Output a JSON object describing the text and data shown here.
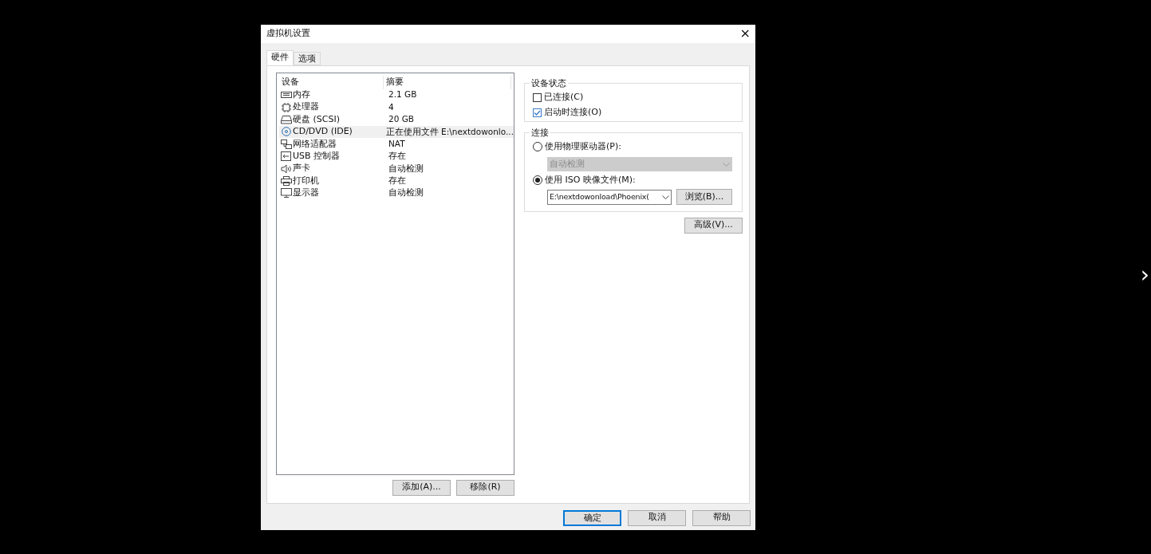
{
  "window": {
    "title": "虚拟机设置",
    "close": "×"
  },
  "tabs": [
    {
      "label": "硬件",
      "selected": true
    },
    {
      "label": "选项",
      "selected": false
    }
  ],
  "devices": {
    "columns": [
      "设备",
      "摘要"
    ],
    "rows": [
      {
        "kind": "memory",
        "name": "内存",
        "summary": "2.1 GB",
        "selected": false
      },
      {
        "kind": "cpu",
        "name": "处理器",
        "summary": "4",
        "selected": false
      },
      {
        "kind": "disk",
        "name": "硬盘 (SCSI)",
        "summary": "20 GB",
        "selected": false
      },
      {
        "kind": "cdrom",
        "name": "CD/DVD (IDE)",
        "summary": "正在使用文件 E:\\nextdowonlo...",
        "selected": true
      },
      {
        "kind": "network",
        "name": "网络适配器",
        "summary": "NAT",
        "selected": false
      },
      {
        "kind": "usb",
        "name": "USB 控制器",
        "summary": "存在",
        "selected": false
      },
      {
        "kind": "sound",
        "name": "声卡",
        "summary": "自动检测",
        "selected": false
      },
      {
        "kind": "printer",
        "name": "打印机",
        "summary": "存在",
        "selected": false
      },
      {
        "kind": "display",
        "name": "显示器",
        "summary": "自动检测",
        "selected": false
      }
    ],
    "buttons": [
      "添加(A)...",
      "移除(R)"
    ]
  },
  "device_status": {
    "title": "设备状态",
    "options": [
      {
        "label": "已连接(C)",
        "checked": false
      },
      {
        "label": "启动时连接(O)",
        "checked": true
      }
    ]
  },
  "connection": {
    "title": "连接",
    "physical": {
      "label": "使用物理驱动器(P):",
      "selected": false,
      "dropdown": {
        "value": "自动检测",
        "disabled": true
      }
    },
    "iso": {
      "label": "使用 ISO 映像文件(M):",
      "selected": true,
      "path": "E:\\nextdowonload\\Phoenix(",
      "browse": "浏览(B)..."
    }
  },
  "advanced": "高级(V)...",
  "footer": [
    {
      "label": "确定",
      "default": true
    },
    {
      "label": "取消",
      "default": false
    },
    {
      "label": "帮助",
      "default": false
    }
  ],
  "viewer": {
    "next": "›"
  }
}
